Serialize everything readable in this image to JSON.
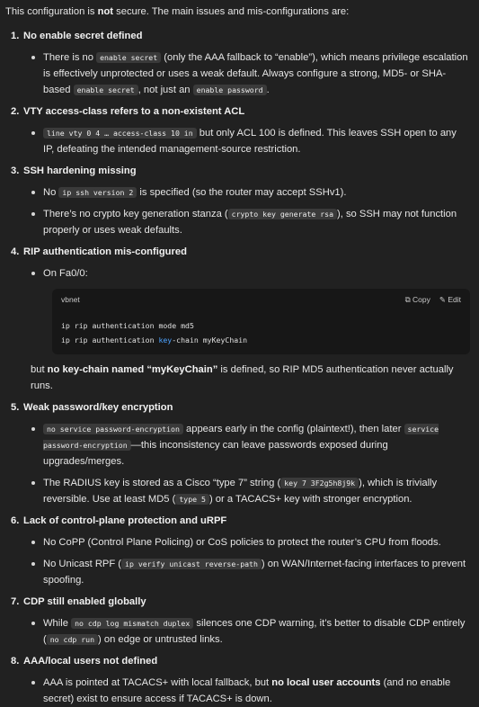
{
  "intro": {
    "before": "This configuration is ",
    "bold": "not",
    "after": " secure. The main issues and mis-configurations are:"
  },
  "sections": [
    {
      "num": "1.",
      "title": "No enable secret defined"
    },
    {
      "num": "2.",
      "title": "VTY access-class refers to a non-existent ACL"
    },
    {
      "num": "3.",
      "title": "SSH hardening missing"
    },
    {
      "num": "4.",
      "title": "RIP authentication mis-configured"
    },
    {
      "num": "5.",
      "title": "Weak password/key encryption"
    },
    {
      "num": "6.",
      "title": "Lack of control-plane protection and uRPF"
    },
    {
      "num": "7.",
      "title": "CDP still enabled globally"
    },
    {
      "num": "8.",
      "title": "AAA/local users not defined"
    }
  ],
  "s1": {
    "t1": "There is no ",
    "c1": "enable secret",
    "t2": " (only the AAA fallback to “enable”), which means privilege escalation is effectively unprotected or uses a weak default. Always configure a strong, MD5- or SHA-based ",
    "c2": "enable secret",
    "t3": ", not just an ",
    "c3": "enable password",
    "t4": "."
  },
  "s2": {
    "c1": "line vty 0 4 … access-class 10 in",
    "t1": " but only ACL 100 is defined. This leaves SSH open to any IP, defeating the intended management-source restriction."
  },
  "s3": {
    "b1": {
      "t1": "No ",
      "c1": "ip ssh version 2",
      "t2": " is specified (so the router may accept SSHv1)."
    },
    "b2": {
      "t1": "There’s no crypto key generation stanza (",
      "c1": "crypto key generate rsa",
      "t2": "), so SSH may not function properly or uses weak defaults."
    }
  },
  "s4": {
    "b1": "On Fa0/0:",
    "code": {
      "lang": "vbnet",
      "copy": "Copy",
      "edit": "Edit",
      "line1": "ip rip authentication mode md5",
      "line2a": "ip rip authentication ",
      "line2kw": "key",
      "line2b": "-chain myKeyChain"
    },
    "after": {
      "t1": "but ",
      "b1": "no key-chain named “myKeyChain”",
      "t2": " is defined, so RIP MD5 authentication never actually runs."
    }
  },
  "s5": {
    "b1": {
      "c1": "no service password-encryption",
      "t1": " appears early in the config (plaintext!), then later ",
      "c2": "service password-encryption",
      "t2": "—this inconsistency can leave passwords exposed during upgrades/merges."
    },
    "b2": {
      "t1": "The RADIUS key is stored as a Cisco “type 7” string (",
      "c1": "key 7 3F2g5h8j9k",
      "t2": "), which is trivially reversible. Use at least MD5 (",
      "c2": "type 5",
      "t3": ") or a TACACS+ key with stronger encryption."
    }
  },
  "s6": {
    "b1": "No CoPP (Control Plane Policing) or CoS policies to protect the router’s CPU from floods.",
    "b2": {
      "t1": "No Unicast RPF (",
      "c1": "ip verify unicast reverse-path",
      "t2": ") on WAN/Internet-facing interfaces to prevent spoofing."
    }
  },
  "s7": {
    "t1": "While ",
    "c1": "no cdp log mismatch duplex",
    "t2": " silences one CDP warning, it’s better to disable CDP entirely (",
    "c2": "no cdp run",
    "t3": ") on edge or untrusted links."
  },
  "s8": {
    "t1": "AAA is pointed at TACACS+ with local fallback, but ",
    "b1": "no local user accounts",
    "t2": " (and no enable secret) exist to ensure access if TACACS+ is down."
  }
}
